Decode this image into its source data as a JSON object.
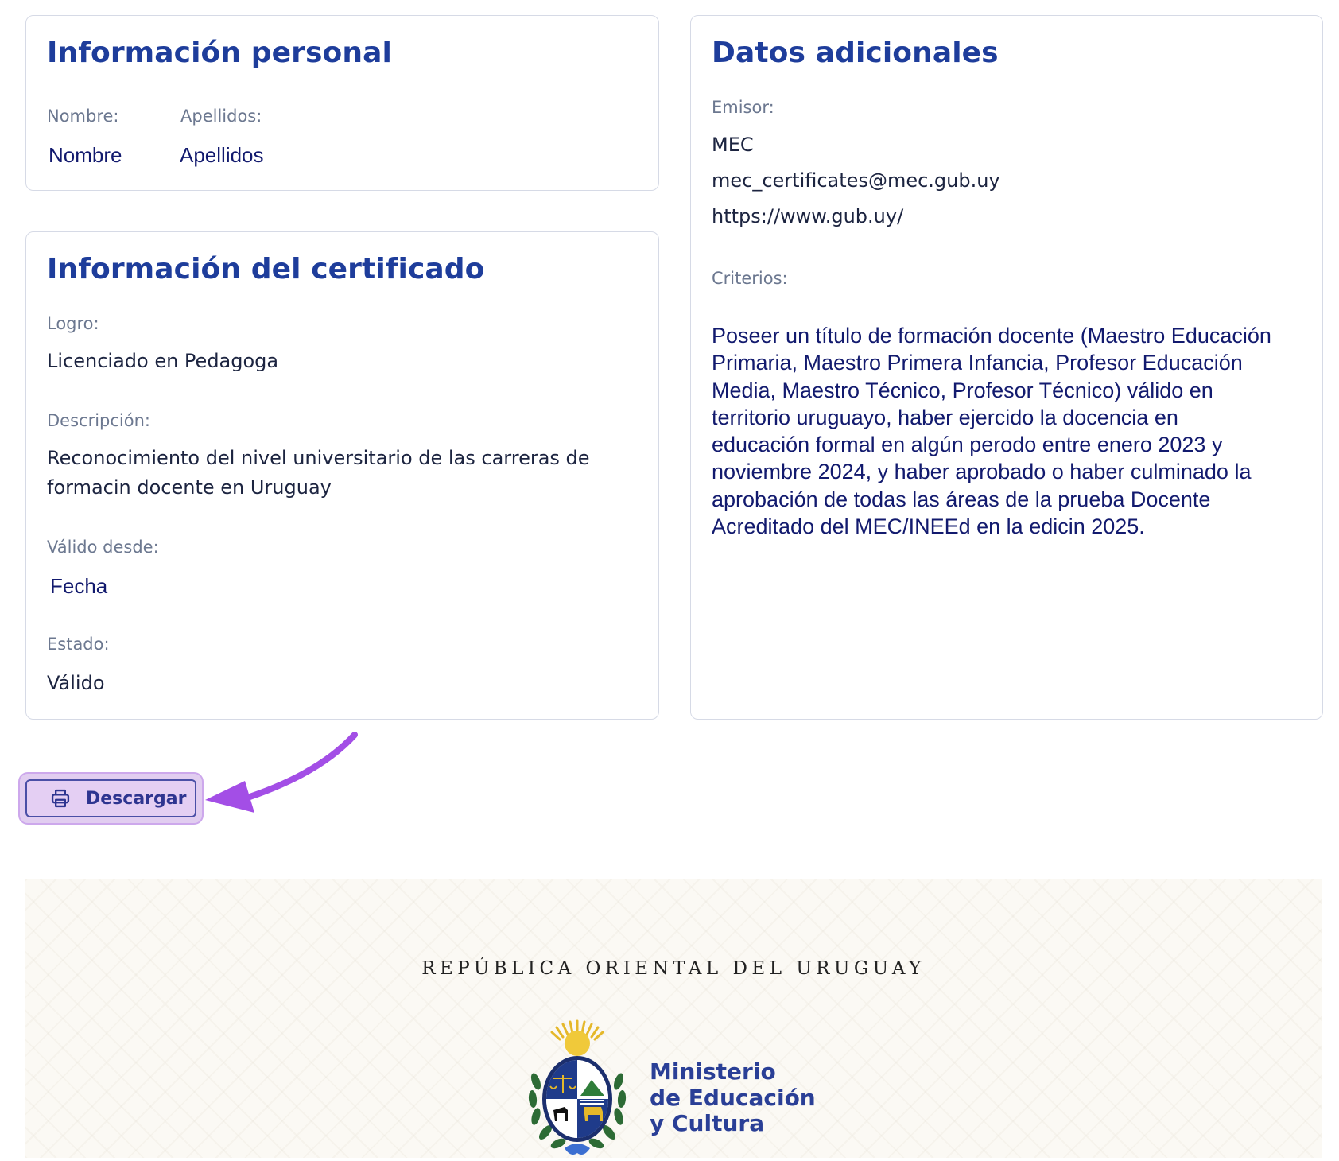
{
  "personal": {
    "title": "Información personal",
    "nombre_label": "Nombre:",
    "apellidos_label": "Apellidos:",
    "nombre_value": "Nombre",
    "apellidos_value": "Apellidos"
  },
  "certificate": {
    "title": "Información del certificado",
    "logro_label": "Logro:",
    "logro_value": "Licenciado en Pedagoga",
    "descripcion_label": "Descripción:",
    "descripcion_line1": "Reconocimiento del nivel universitario de las carreras de",
    "descripcion_line2": "formacin docente en Uruguay",
    "valido_label": "Válido desde:",
    "valido_value": "Fecha",
    "estado_label": "Estado:",
    "estado_value": "Válido"
  },
  "additional": {
    "title": "Datos adicionales",
    "emisor_label": "Emisor:",
    "emisor_name": "MEC",
    "emisor_email": "mec_certificates@mec.gub.uy",
    "emisor_url": "https://www.gub.uy/",
    "criterios_label": "Criterios:",
    "criterios_lines": [
      "Poseer un título de formación docente (Maestro Educación",
      "Primaria, Maestro Primera Infancia, Profesor Educación",
      "Media, Maestro Técnico, Profesor Técnico) válido en",
      "territorio uruguayo, haber ejercido la docencia en",
      "educación formal en algún perodo entre enero 2023 y",
      "noviembre 2024, y haber aprobado o haber culminado la",
      "aprobación de todas las áreas de la prueba Docente",
      "Acreditado del MEC/INEEd en la edicin 2025."
    ]
  },
  "download": {
    "label": "Descargar",
    "icon": "printer-icon"
  },
  "footer": {
    "country": "REPÚBLICA ORIENTAL DEL URUGUAY",
    "ministry_line1": "Ministerio",
    "ministry_line2": "de Educación",
    "ministry_line3": "y Cultura"
  },
  "colors": {
    "heading": "#1e3d9b",
    "label": "#6c7890",
    "value_navy": "#121a6e",
    "button_bg": "#e4cff3",
    "arrow": "#a34ee6"
  }
}
